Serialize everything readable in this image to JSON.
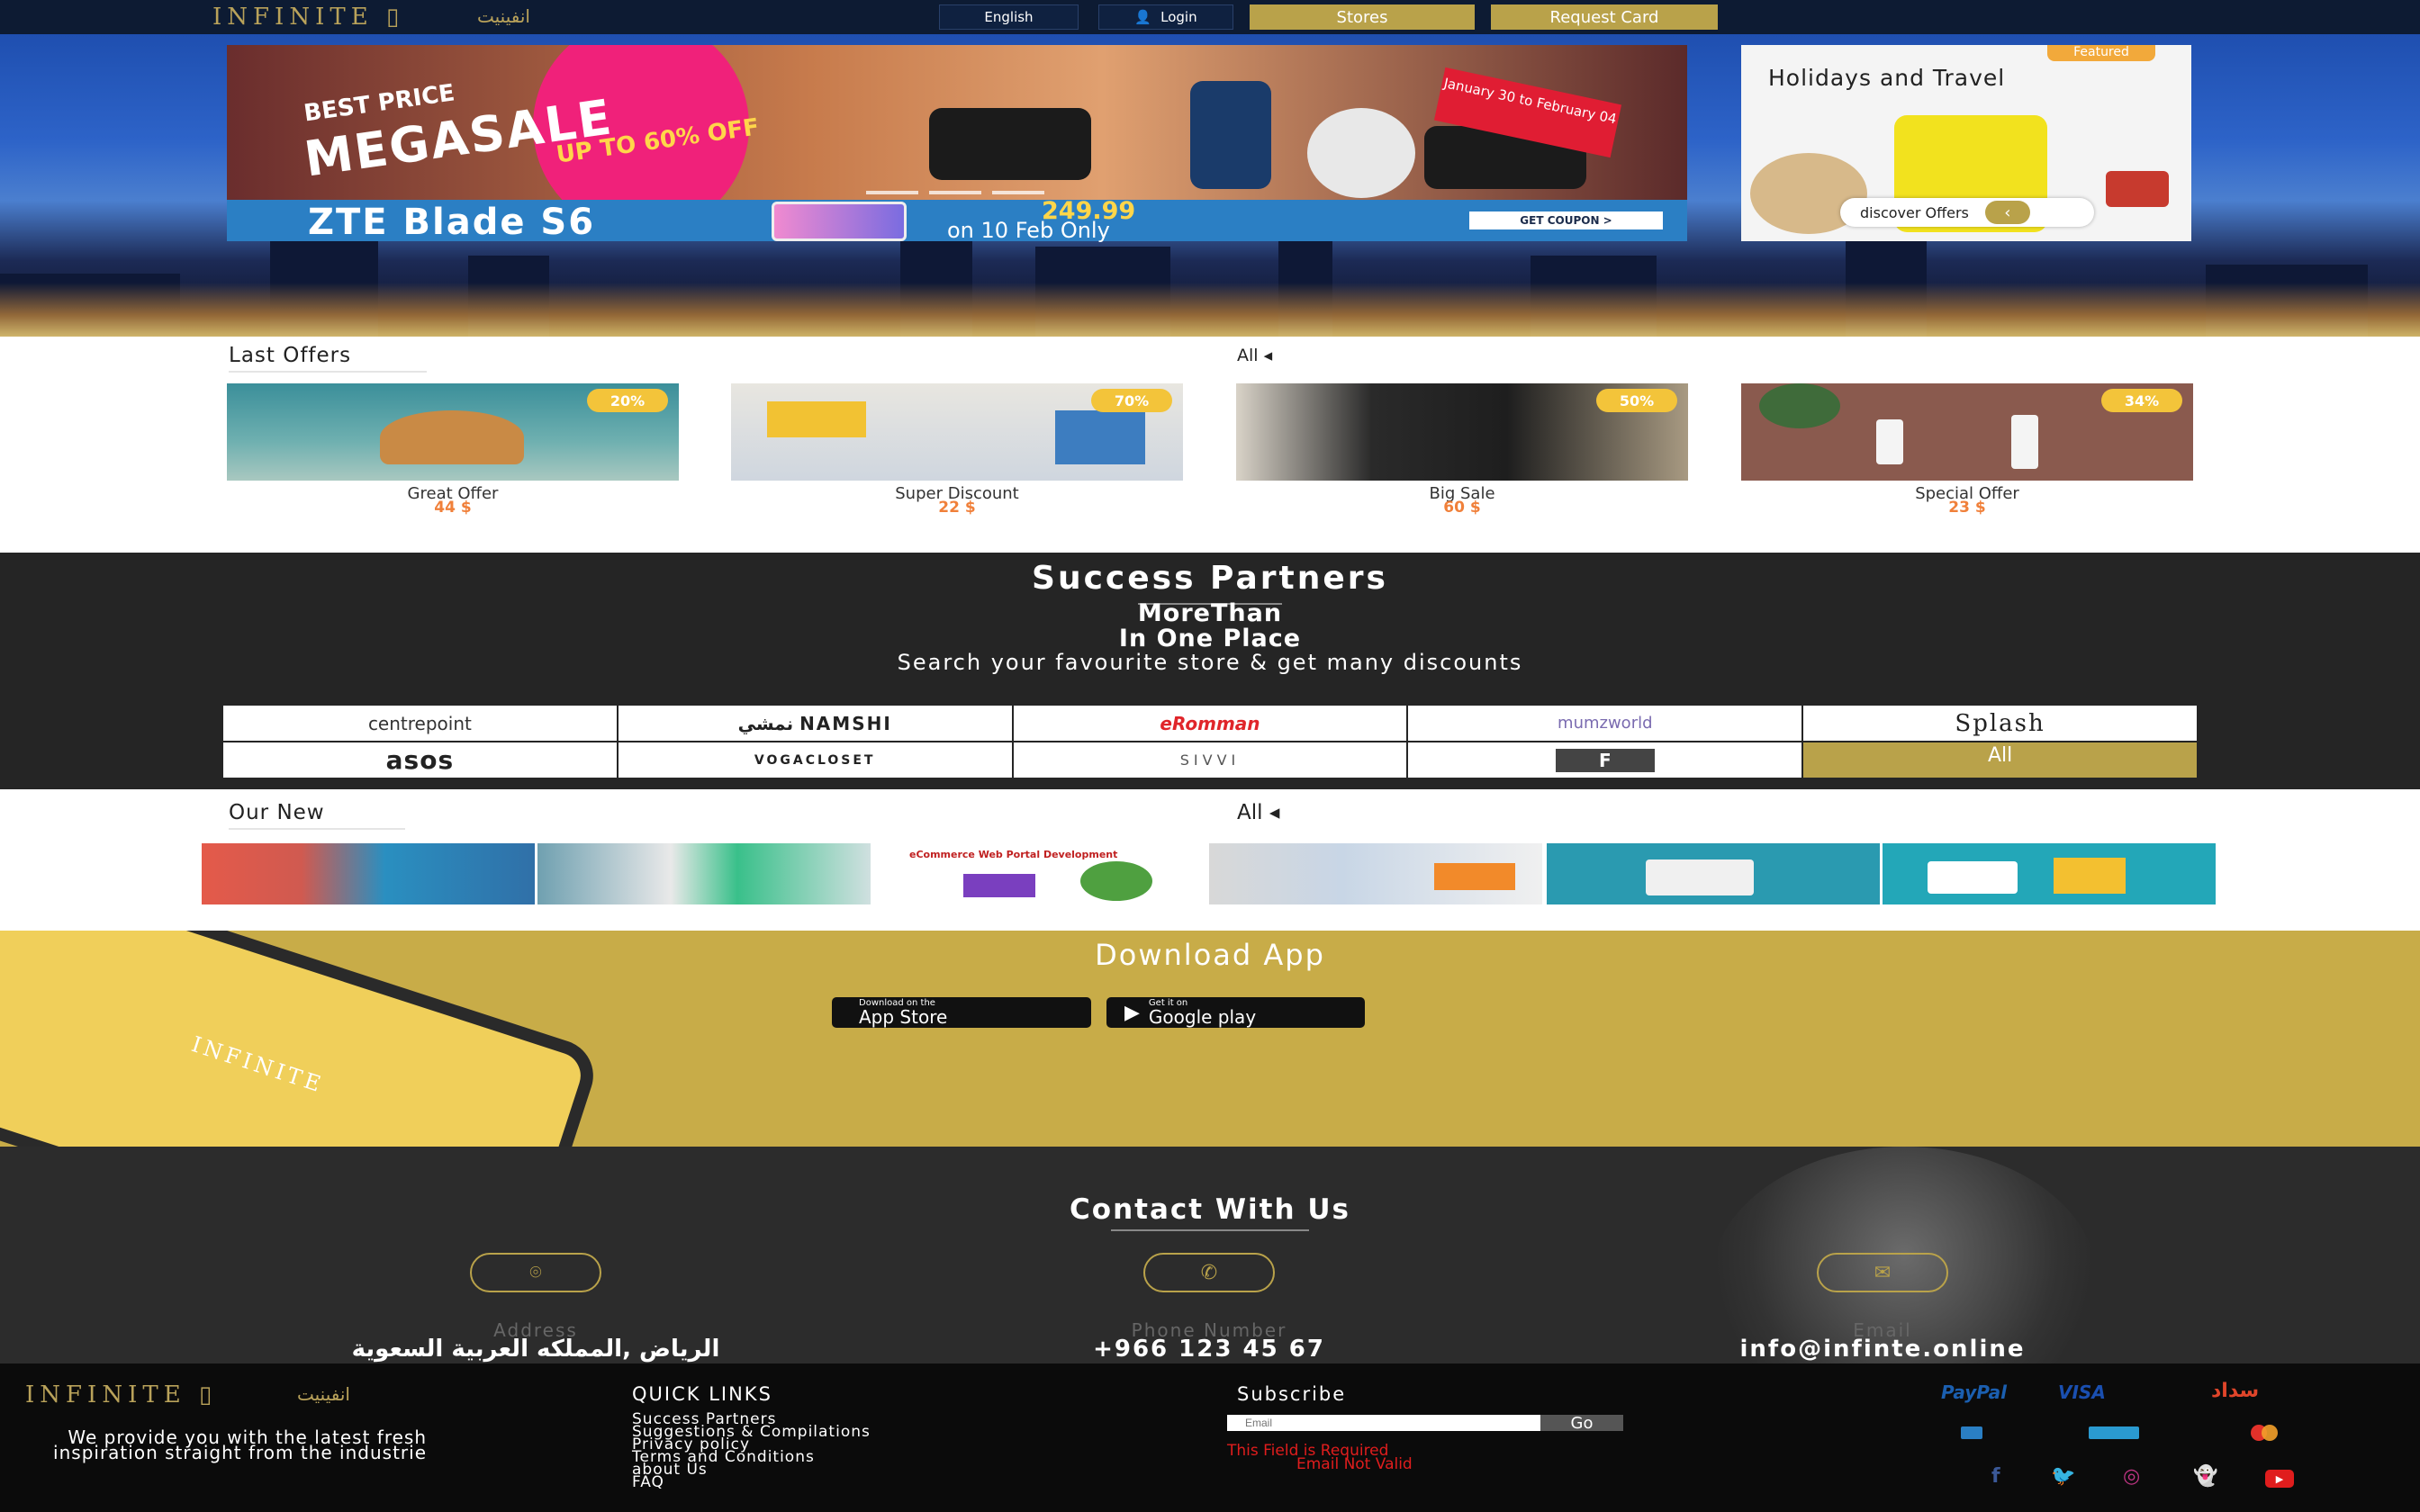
{
  "header": {
    "logo": "INFINITE",
    "logo_ar": "انفينيت",
    "language": "English",
    "login": "Login",
    "stores": "Stores",
    "request_card": "Request Card"
  },
  "hero": {
    "slider": {
      "best_price": "BEST PRICE",
      "megasale": "MEGASALE",
      "up_to": "UP TO 60% OFF",
      "date_tag": "January 30 to February 04",
      "strip_title": "ZTE Blade S6",
      "strip_price": "249.99",
      "strip_on": "on 10 Feb Only",
      "coupon": "GET COUPON >"
    },
    "featured": {
      "badge": "Featured",
      "title": "Holidays and Travel",
      "discover": "discover Offers"
    }
  },
  "last_offers": {
    "title": "Last Offers",
    "all": "All ◂",
    "items": [
      {
        "name": "Great Offer",
        "price": "44 $",
        "discount": "20%"
      },
      {
        "name": "Super Discount",
        "price": "22 $",
        "discount": "70%"
      },
      {
        "name": "Big Sale",
        "price": "60 $",
        "discount": "50%"
      },
      {
        "name": "Special Offer",
        "price": "23 $",
        "discount": "34%"
      }
    ]
  },
  "partners": {
    "title": "Success Partners",
    "line1": "MoreThan",
    "line2": "In One Place",
    "line3": "Search your favourite store & get many discounts",
    "logos": [
      "centrepoint",
      "نمشي NAMSHI",
      "eRomman",
      "mumzworld",
      "Splash",
      "asos",
      "VOGACLOSET",
      "SIVVI",
      "F"
    ],
    "all": "All"
  },
  "our_new": {
    "title": "Our New",
    "all": "All ◂"
  },
  "download": {
    "title": "Download App",
    "app_store_small": "Download on the",
    "app_store": "App Store",
    "google_small": "Get it on",
    "google": "Google play"
  },
  "contact": {
    "title": "Contact With Us",
    "address_label": "Address",
    "address": "الرياض ,المملكه العربية السعوية",
    "phone_label": "Phone Number",
    "phone": "+966  123 45 67",
    "email_label": "Email",
    "email": "info@infinte.online"
  },
  "footer": {
    "logo": "INFINITE",
    "logo_ar": "انفينيت",
    "tagline": "We provide you with the latest fresh inspiration straight from the industrie",
    "quick_links_title": "QUICK LINKS",
    "quick_links": [
      "Success Partners",
      "Suggestions & Compilations",
      "Privacy policy",
      "Terms and Conditions",
      "about Us",
      "FAQ"
    ],
    "subscribe_title": "Subscribe",
    "email_placeholder": "Email",
    "go": "Go",
    "error_required": "This Field is Required",
    "error_invalid": "Email Not Valid",
    "payments": [
      "PayPal",
      "VISA",
      "سداد"
    ]
  },
  "colors": {
    "gold": "#b9a24a",
    "navy": "#0d1b33",
    "orange": "#f0803a",
    "error": "#e01d1d"
  }
}
